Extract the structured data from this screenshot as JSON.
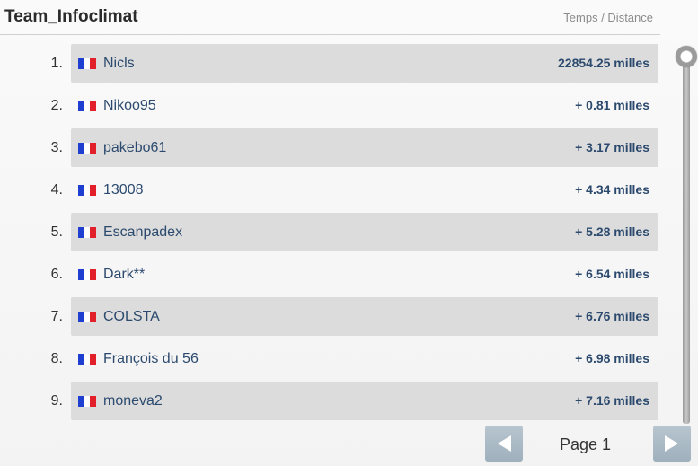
{
  "header": {
    "team_name": "Team_Infoclimat",
    "column_label": "Temps / Distance"
  },
  "rows": [
    {
      "rank": "1.",
      "name": "Nicls",
      "distance": "22854.25 milles",
      "flag": "france-flag"
    },
    {
      "rank": "2.",
      "name": "Nikoo95",
      "distance": "+ 0.81 milles",
      "flag": "france-flag"
    },
    {
      "rank": "3.",
      "name": "pakebo61",
      "distance": "+ 3.17 milles",
      "flag": "france-flag"
    },
    {
      "rank": "4.",
      "name": "13008",
      "distance": "+ 4.34 milles",
      "flag": "france-flag"
    },
    {
      "rank": "5.",
      "name": "Escanpadex",
      "distance": "+ 5.28 milles",
      "flag": "france-flag"
    },
    {
      "rank": "6.",
      "name": "Dark**",
      "distance": "+ 6.54 milles",
      "flag": "france-flag"
    },
    {
      "rank": "7.",
      "name": "COLSTA",
      "distance": "+ 6.76 milles",
      "flag": "france-flag"
    },
    {
      "rank": "8.",
      "name": "François du 56",
      "distance": "+ 6.98 milles",
      "flag": "france-flag"
    },
    {
      "rank": "9.",
      "name": "moneva2",
      "distance": "+ 7.16 milles",
      "flag": "france-flag"
    }
  ],
  "pager": {
    "label": "Page 1",
    "prev_icon": "arrow-left-icon",
    "next_icon": "arrow-right-icon"
  },
  "colors": {
    "row_shade": "#dcdcdc",
    "text_blue": "#2c4a6e",
    "pager_button": "#a9b9c4"
  }
}
